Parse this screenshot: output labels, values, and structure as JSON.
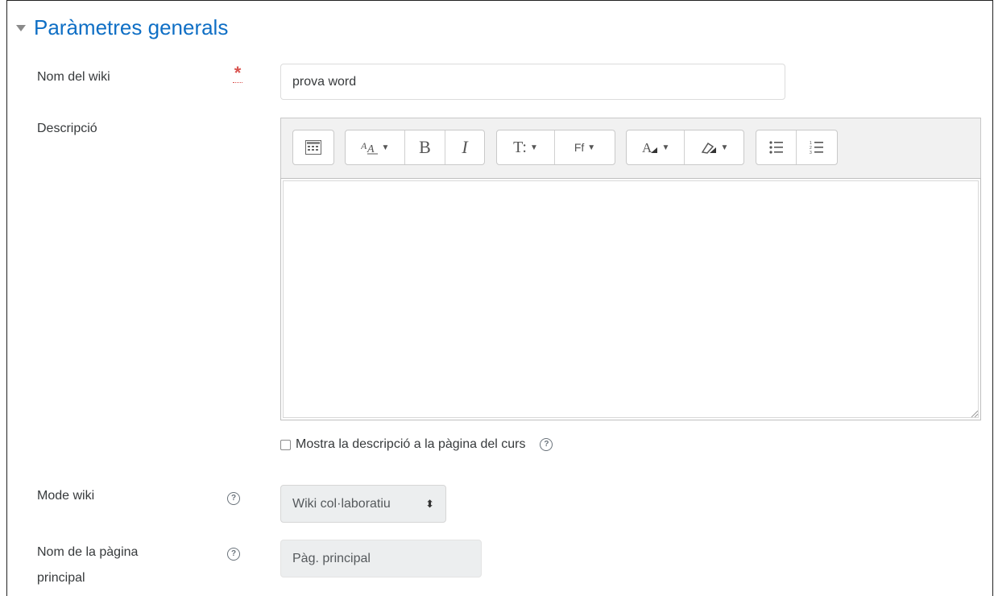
{
  "section": {
    "title": "Paràmetres generals",
    "collapse_icon": "triangle-down-icon"
  },
  "form": {
    "name_label": "Nom del wiki",
    "name_value": "prova word",
    "required_icon": "asterisk-icon",
    "description_label": "Descripció",
    "show_description_label": "Mostra la descripció a la pàgina del curs",
    "mode_label": "Mode wiki",
    "mode_value": "Wiki col·laboratiu",
    "mode_arrow": "⬍",
    "mainpage_label_line1": "Nom de la pàgina",
    "mainpage_label_line2": "principal",
    "mainpage_value": "Pàg. principal",
    "help_icon": "?"
  },
  "editor": {
    "toolbar": [
      {
        "name": "toggle-toolbar",
        "icon": "show-more-icon"
      },
      {
        "name": "paragraph-styles",
        "icon": "font-size-icon",
        "dropdown": true
      },
      {
        "name": "bold",
        "text": "B"
      },
      {
        "name": "italic",
        "text": "I"
      },
      {
        "name": "font-size",
        "text": "T:",
        "dropdown": true
      },
      {
        "name": "font-family",
        "text": "Ff",
        "dropdown": true
      },
      {
        "name": "font-color",
        "icon": "font-color-icon",
        "dropdown": true
      },
      {
        "name": "background-color",
        "icon": "highlight-icon",
        "dropdown": true
      },
      {
        "name": "unordered-list",
        "icon": "bullet-list-icon"
      },
      {
        "name": "ordered-list",
        "icon": "numbered-list-icon"
      }
    ],
    "dropdown_arrow": "▼"
  },
  "colors": {
    "accent": "#0f6fc5",
    "required": "#d9534f",
    "toolbar_bg": "#f1f1f1",
    "disabled_bg": "#eceeef"
  }
}
